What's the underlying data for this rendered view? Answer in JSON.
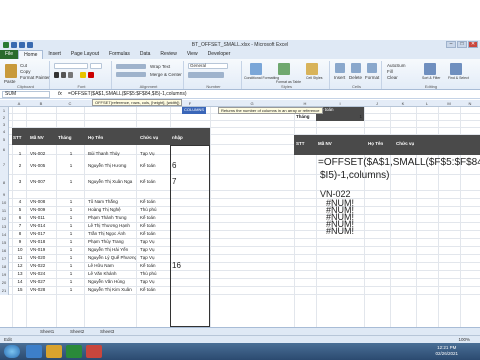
{
  "window": {
    "title": "BT_OFFSET_SMALL.xlsx - Microsoft Excel"
  },
  "tabs": [
    "File",
    "Home",
    "Insert",
    "Page Layout",
    "Formulas",
    "Data",
    "Review",
    "View",
    "Developer"
  ],
  "ribbon": {
    "clipboard": {
      "paste": "Paste",
      "cut": "Cut",
      "copy": "Copy",
      "format_painter": "Format Painter",
      "label": "Clipboard"
    },
    "font": {
      "label": "Font"
    },
    "alignment": {
      "wrap": "Wrap Text",
      "merge": "Merge & Center",
      "label": "Alignment"
    },
    "number": {
      "format": "General",
      "label": "Number"
    },
    "styles": {
      "cond": "Conditional Formatting",
      "table": "Format as Table",
      "cell": "Cell Styles",
      "label": "Styles"
    },
    "cells": {
      "insert": "Insert",
      "delete": "Delete",
      "format": "Format",
      "label": "Cells"
    },
    "editing": {
      "autosum": "AutoSum",
      "fill": "Fill",
      "clear": "Clear",
      "sort": "Sort & Filter",
      "find": "Find & Select",
      "label": "Editing"
    }
  },
  "formula_bar": {
    "name_box": "SUM",
    "fx": "fx",
    "formula": "=OFFSET($A$1,SMALL($F$5:$F$84,$I5)-1,columns)"
  },
  "tooltip": "OFFSET(reference, rows, cols, [height], [width])",
  "column_tip": {
    "label": "COLUMNS",
    "text": "Returns the number of columns in an array or reference"
  },
  "columns": [
    "A",
    "B",
    "C",
    "D",
    "E",
    "F",
    "G",
    "H",
    "I",
    "J",
    "K",
    "L",
    "M",
    "N",
    "O"
  ],
  "left_table": {
    "headers": [
      "STT",
      "Mã NV",
      "Tháng",
      "Họ Tên",
      "Chức vụ",
      "nhập"
    ],
    "rows": [
      {
        "stt": "1",
        "ma": "VN-002",
        "thang": "1",
        "ten": "Bùi Thanh Thủy",
        "cv": "Tạp Vụ",
        "f": ""
      },
      {
        "stt": "2",
        "ma": "VN-005",
        "thang": "1",
        "ten": "Nguyễn Thị Hương",
        "cv": "Kế toán",
        "f": "6"
      },
      {
        "stt": "3",
        "ma": "VN-007",
        "thang": "1",
        "ten": "Nguyễn Thị Xuân Nga",
        "cv": "Kế toán",
        "f": "7"
      },
      {
        "stt": "4",
        "ma": "VN-008",
        "thang": "1",
        "ten": "Tô Nam Thắng",
        "cv": "Kế toán",
        "f": ""
      },
      {
        "stt": "5",
        "ma": "VN-009",
        "thang": "1",
        "ten": "Hoàng Thị Nghệ",
        "cv": "Thủ phú",
        "f": ""
      },
      {
        "stt": "6",
        "ma": "VN-011",
        "thang": "1",
        "ten": "Phạm Thành Trung",
        "cv": "Kế toán",
        "f": ""
      },
      {
        "stt": "7",
        "ma": "VN-014",
        "thang": "1",
        "ten": "Lê Thị Thương Hạnh",
        "cv": "Kế toán",
        "f": ""
      },
      {
        "stt": "8",
        "ma": "VN-017",
        "thang": "1",
        "ten": "Trần Thị Ngọc Ánh",
        "cv": "Kế toán",
        "f": ""
      },
      {
        "stt": "9",
        "ma": "VN-018",
        "thang": "1",
        "ten": "Phạm Thùy Trang",
        "cv": "Tạp Vụ",
        "f": ""
      },
      {
        "stt": "10",
        "ma": "VN-019",
        "thang": "1",
        "ten": "Nguyễn Thị Hải Yến",
        "cv": "Tạp Vụ",
        "f": ""
      },
      {
        "stt": "11",
        "ma": "VN-020",
        "thang": "1",
        "ten": "Nguyễn Lý Quế Phương",
        "cv": "Tạp Vụ",
        "f": ""
      },
      {
        "stt": "12",
        "ma": "VN-022",
        "thang": "1",
        "ten": "Lê Hữu Nam",
        "cv": "Kế toán",
        "f": "16"
      },
      {
        "stt": "13",
        "ma": "VN-024",
        "thang": "1",
        "ten": "Lê Văn Khánh",
        "cv": "Thủ phú",
        "f": ""
      },
      {
        "stt": "14",
        "ma": "VN-027",
        "thang": "1",
        "ten": "Nguyễn Văn Hùng",
        "cv": "Tạp Vụ",
        "f": ""
      },
      {
        "stt": "15",
        "ma": "VN-028",
        "thang": "1",
        "ten": "Nguyễn Thị Kim Xuân",
        "cv": "Kế toán",
        "f": ""
      }
    ]
  },
  "right_table": {
    "criteria_label": "Kế toán",
    "thang_label": "Tháng",
    "thang_value": "1",
    "headers": [
      "STT",
      "Mã NV",
      "Họ Tên",
      "Chức vụ"
    ],
    "formula_display": "=OFFSET($A$1,SMALL($F$5:$F$84,",
    "formula_display2": "$I5)-1,columns)",
    "result": "VN-022",
    "errors": [
      "#NUM!",
      "#NUM!",
      "#NUM!",
      "#NUM!",
      "#NUM!"
    ]
  },
  "row_numbers": [
    "1",
    "2",
    "3",
    "4",
    "5",
    "6",
    "7",
    "8",
    "9",
    "10",
    "11",
    "12",
    "13",
    "14",
    "15",
    "16",
    "17",
    "18",
    "19",
    "20",
    "21"
  ],
  "sheet_tabs": [
    "Sheet1",
    "Sheet2",
    "Sheet3"
  ],
  "status": {
    "mode": "Edit",
    "zoom": "100%"
  },
  "clock": {
    "time": "12:21 PM",
    "date": "02/26/2021"
  }
}
